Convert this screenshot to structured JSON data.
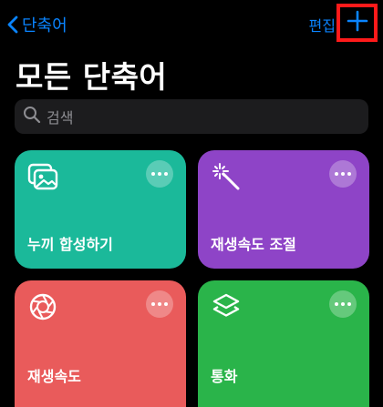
{
  "nav": {
    "back_label": "단축어",
    "edit_label": "편집",
    "add_icon": "plus-icon",
    "accent_color": "#0a84ff",
    "highlight_color": "#ff1a1a"
  },
  "page": {
    "title": "모든 단축어"
  },
  "search": {
    "placeholder": "검색",
    "icon": "search-icon"
  },
  "shortcuts": [
    {
      "label": "누끼 합성하기",
      "color": "#1bb99a",
      "icon": "photos-icon"
    },
    {
      "label": "재생속도 조절",
      "color": "#8e44c7",
      "icon": "magic-wand-icon"
    },
    {
      "label": "재생속도",
      "color": "#e95b5b",
      "icon": "aperture-icon"
    },
    {
      "label": "통화",
      "color": "#2ab44a",
      "icon": "layers-icon"
    }
  ]
}
